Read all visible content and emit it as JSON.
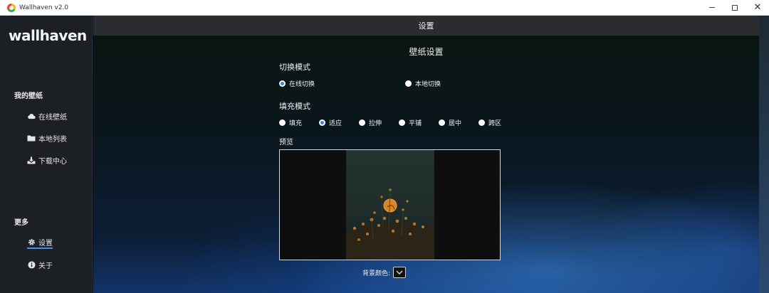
{
  "window": {
    "title": "Wallhaven v2.0",
    "controls": {
      "minimize": "–",
      "maximize": "□",
      "close": "✕"
    }
  },
  "sidebar": {
    "brand": "wallhaven",
    "section_wallpapers": "我的壁纸",
    "items": [
      {
        "label": "在线壁纸",
        "icon": "cloud-icon"
      },
      {
        "label": "本地列表",
        "icon": "folder-icon"
      },
      {
        "label": "下载中心",
        "icon": "download-icon"
      }
    ],
    "section_more": "更多",
    "more_items": [
      {
        "label": "设置",
        "icon": "gear-icon",
        "active": true
      },
      {
        "label": "关于",
        "icon": "info-icon"
      }
    ]
  },
  "header": {
    "title": "设置"
  },
  "settings": {
    "title": "壁纸设置",
    "switch_mode": {
      "label": "切换模式",
      "options": [
        {
          "label": "在线切换",
          "checked": true
        },
        {
          "label": "本地切换",
          "checked": false
        }
      ]
    },
    "fill_mode": {
      "label": "填充模式",
      "options": [
        {
          "label": "填充",
          "checked": false
        },
        {
          "label": "适应",
          "checked": true
        },
        {
          "label": "拉伸",
          "checked": false
        },
        {
          "label": "平铺",
          "checked": false
        },
        {
          "label": "居中",
          "checked": false
        },
        {
          "label": "跨区",
          "checked": false
        }
      ]
    },
    "preview_label": "预览",
    "background_color_label": "背景颜色:",
    "background_color_value": "#111111"
  },
  "colors": {
    "accent": "#3b82d6",
    "sidebar_bg": "#1c1f24",
    "header_bg": "#2a2c2f"
  }
}
